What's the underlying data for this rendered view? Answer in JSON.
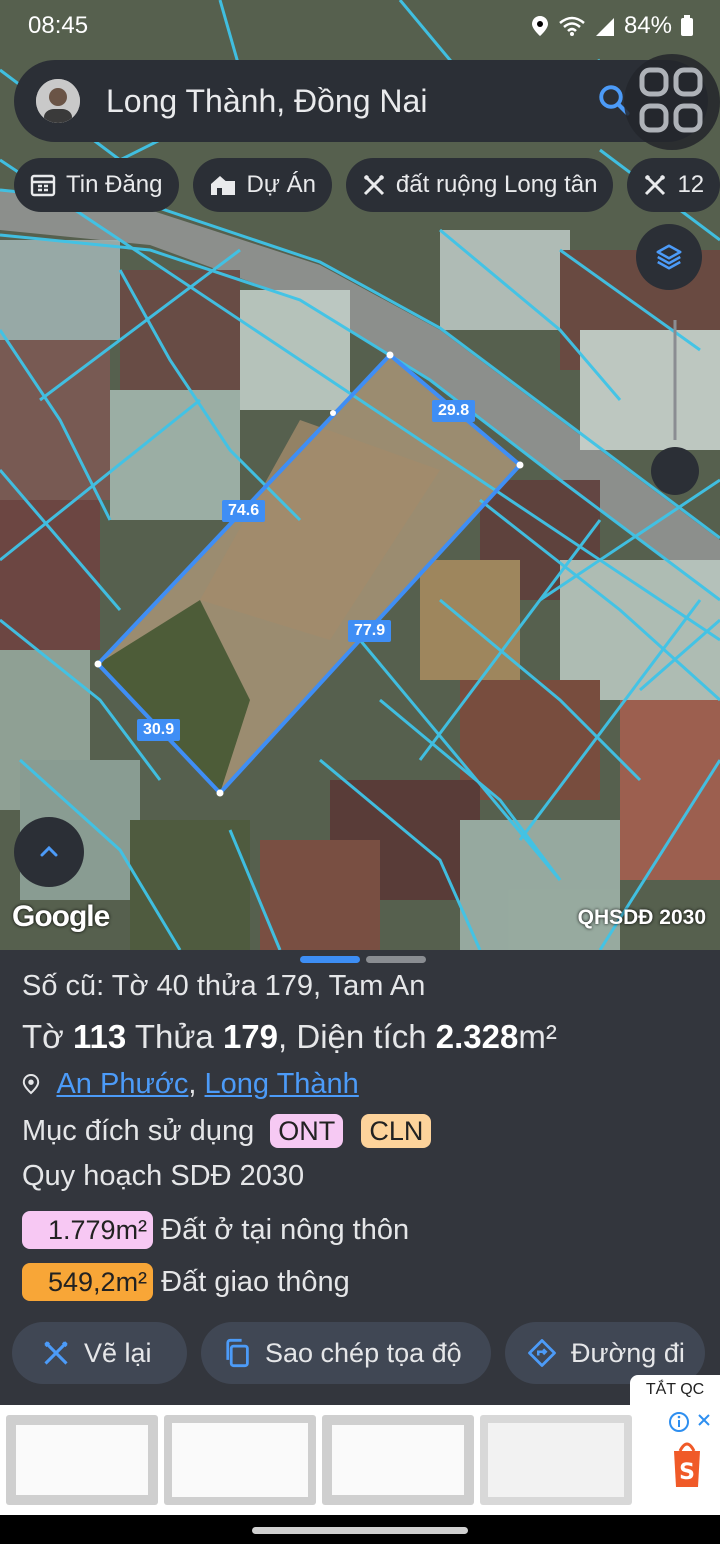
{
  "status_bar": {
    "time": "08:45",
    "battery": "84%"
  },
  "search": {
    "query": "Long Thành, Đồng Nai"
  },
  "chips": [
    {
      "label": "Tin Đăng",
      "icon": "calendar-icon"
    },
    {
      "label": "Dự Án",
      "icon": "house-icon"
    },
    {
      "label": "đất ruộng Long tân",
      "icon": "pencil-ruler-icon"
    },
    {
      "label": "12",
      "icon": "pencil-ruler-icon"
    }
  ],
  "map": {
    "measurements": {
      "top": "29.8",
      "left": "74.6",
      "right": "77.9",
      "bottom": "30.9"
    },
    "attribution": "Google",
    "overlay_label": "QHSDĐ 2030",
    "colors": {
      "parcel_line": "#3f8ef5",
      "cadastral_line": "#3fc4e8"
    }
  },
  "sheet": {
    "old_number": "Số cũ: Tờ 40 thửa 179, Tam An",
    "sheet_label": "Tờ",
    "sheet_no": "113",
    "plot_label": "Thửa",
    "plot_no": "179",
    "area_label": "Diện tích",
    "area_value": "2.328",
    "area_unit": "m²",
    "location_ward": "An Phước",
    "location_district": "Long Thành",
    "purpose_label": "Mục đích sử dụng",
    "purpose_tags": [
      {
        "code": "ONT",
        "color": "#f6c9f3"
      },
      {
        "code": "CLN",
        "color": "#fdd39b"
      }
    ],
    "planning_title": "Quy hoạch SDĐ 2030",
    "planning": [
      {
        "area": "1.779m²",
        "desc": "Đất ở tại nông thôn",
        "color": "#f7c8f3"
      },
      {
        "area": "549,2m²",
        "desc": "Đất giao thông",
        "color": "#f8a637"
      }
    ],
    "buttons": {
      "redraw": "Vẽ lại",
      "copy_coords": "Sao chép tọa độ",
      "directions": "Đường đi"
    }
  },
  "ad": {
    "close_label": "TẮT QC"
  }
}
